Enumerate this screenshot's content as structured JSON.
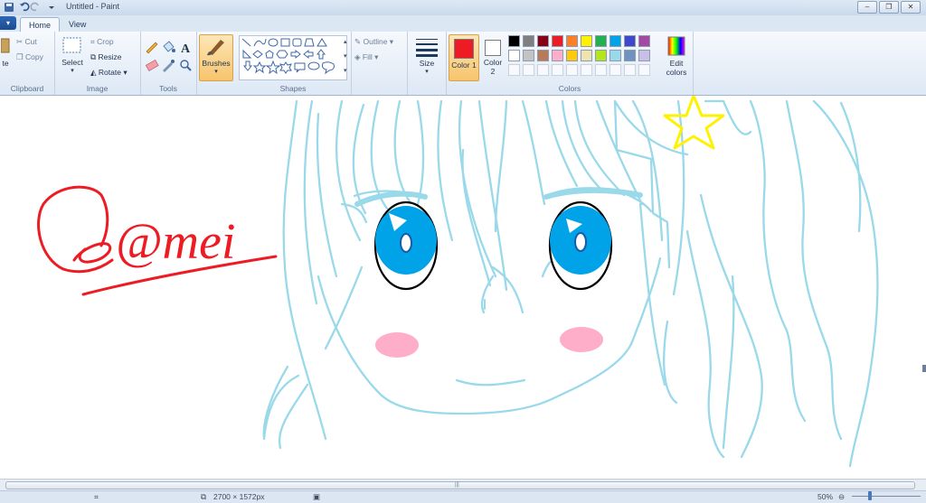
{
  "window": {
    "title": "Untitled - Paint"
  },
  "tabs": [
    {
      "label": "Home"
    },
    {
      "label": "View"
    }
  ],
  "ribbon": {
    "clipboard": {
      "label": "Clipboard",
      "paste_label": "te",
      "cut_label": "Cut",
      "copy_label": "Copy"
    },
    "image": {
      "label": "Image",
      "select_label": "Select",
      "crop_label": "Crop",
      "resize_label": "Resize",
      "rotate_label": "Rotate"
    },
    "tools": {
      "label": "Tools",
      "brushes_label": "Brushes"
    },
    "shapes": {
      "label": "Shapes",
      "outline_label": "Outline",
      "fill_label": "Fill"
    },
    "size": {
      "label": "Size"
    },
    "colors": {
      "label": "Colors",
      "color1_label": "Color 1",
      "color2_label": "Color 2",
      "edit_label": "Edit colors",
      "color1_value": "#ed1c24",
      "color2_value": "#ffffff",
      "palette_row1": [
        "#000000",
        "#7f7f7f",
        "#880015",
        "#ed1c24",
        "#ff7f27",
        "#fff200",
        "#22b14c",
        "#00a2e8",
        "#3f48cc",
        "#a349a4"
      ],
      "palette_row2": [
        "#ffffff",
        "#c3c3c3",
        "#b97a57",
        "#ffaec9",
        "#ffc90e",
        "#efe4b0",
        "#b5e61d",
        "#99d9ea",
        "#7092be",
        "#c8bfe7"
      ]
    }
  },
  "canvas": {
    "signature_text": "@mei",
    "colors": {
      "hair": "#99d9ea",
      "iris": "#00a2e8",
      "signature": "#ed1c24",
      "star": "#fff200",
      "blush": "#ffaec9"
    }
  },
  "status": {
    "dimensions": "2700 × 1572px",
    "zoom": "50%"
  }
}
